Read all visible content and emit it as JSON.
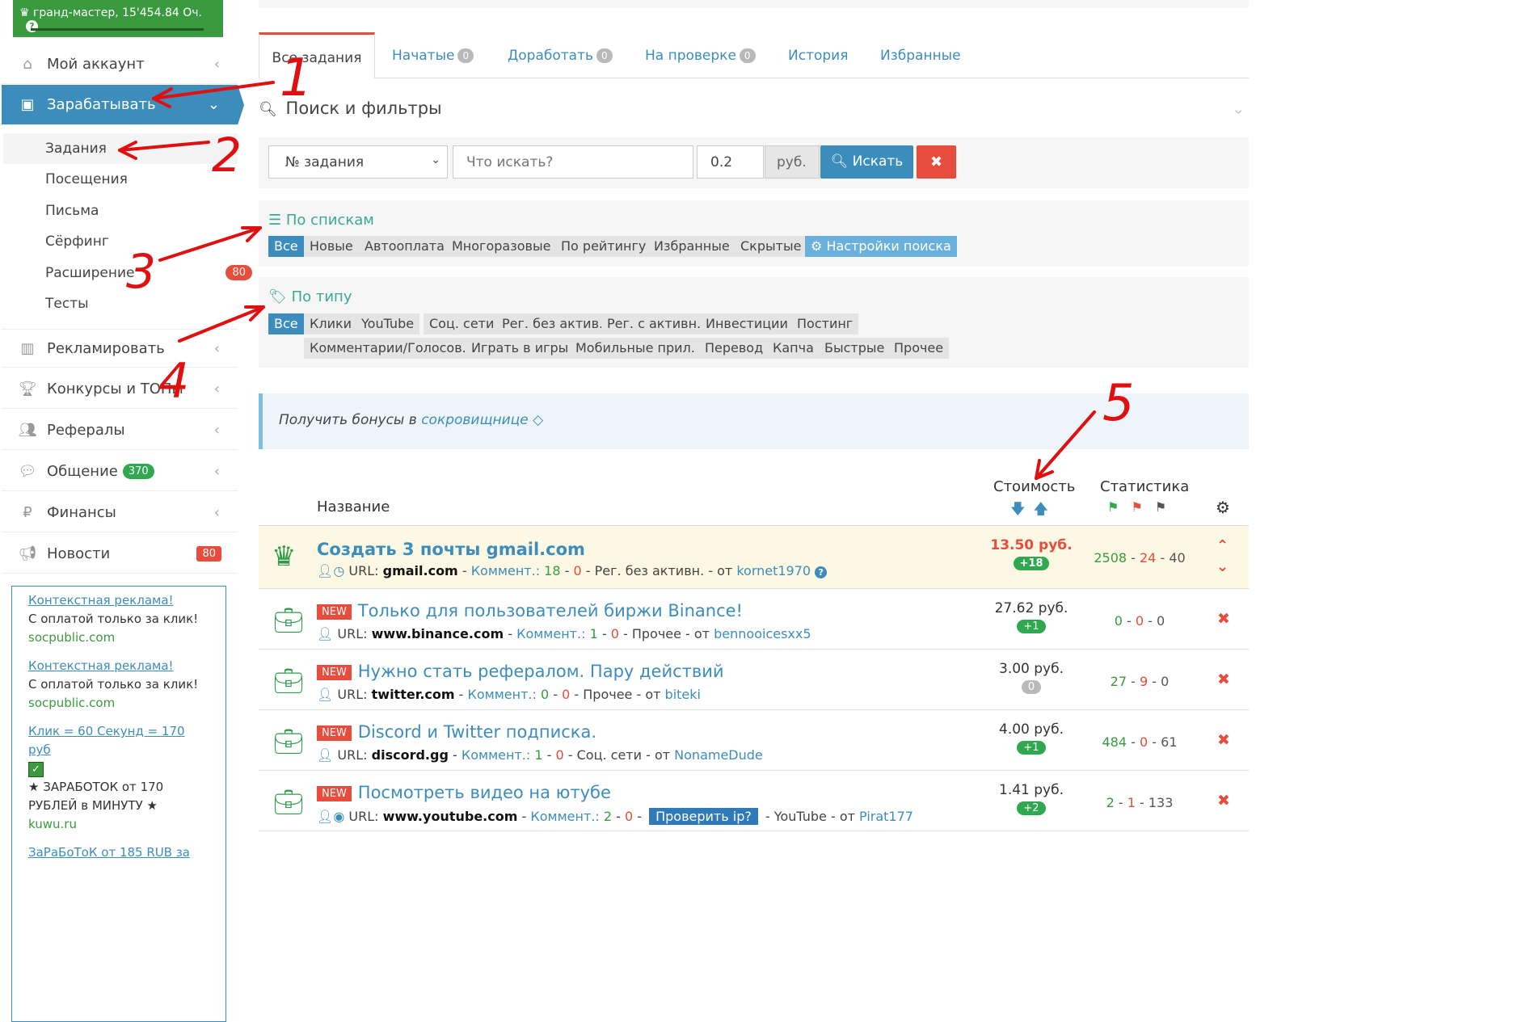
{
  "sidebar": {
    "rank": "гранд-мастер, 15'454.84 Оч.",
    "help": "?",
    "menu": [
      {
        "label": "Мой аккаунт",
        "icon": "home-icon"
      },
      {
        "label": "Зарабатывать",
        "icon": "briefcase-icon"
      },
      {
        "label": "Рекламировать",
        "icon": "bar-chart-icon"
      },
      {
        "label": "Конкурсы и ТОПы",
        "icon": "trophy-icon"
      },
      {
        "label": "Рефералы",
        "icon": "users-icon"
      },
      {
        "label": "Общение",
        "icon": "comments-icon",
        "badge": "370"
      },
      {
        "label": "Финансы",
        "icon": "ruble-icon"
      },
      {
        "label": "Новости",
        "icon": "megaphone-icon",
        "badge": "80"
      }
    ],
    "submenu": [
      {
        "label": "Задания"
      },
      {
        "label": "Посещения"
      },
      {
        "label": "Письма"
      },
      {
        "label": "Сёрфинг"
      },
      {
        "label": "Расширение",
        "badge": "80"
      },
      {
        "label": "Тесты"
      }
    ],
    "ads": [
      {
        "link": "Контекстная реклама!",
        "text": "С оплатой только за клик!",
        "site": "socpublic.com"
      },
      {
        "link": "Контекстная реклама!",
        "text": "С оплатой только за клик!",
        "site": "socpublic.com"
      },
      {
        "link": "Клик = 60 Секунд = 170 руб",
        "text": "★ ЗАРАБОТОК от 170 РУБЛЕЙ в МИНУТУ ★",
        "site": "kuwu.ru"
      },
      {
        "link": "ЗаРаБоТоК от 185 RUB за"
      }
    ]
  },
  "tabs": [
    {
      "label": "Все задания"
    },
    {
      "label": "Начатые",
      "count": "0"
    },
    {
      "label": "Доработать",
      "count": "0"
    },
    {
      "label": "На проверке",
      "count": "0"
    },
    {
      "label": "История"
    },
    {
      "label": "Избранные"
    }
  ],
  "filters": {
    "title": "Поиск и фильтры",
    "select_value": "№ задания",
    "search_placeholder": "Что искать?",
    "price_value": "0.2",
    "currency": "руб.",
    "search_button": "Искать"
  },
  "lists": {
    "title": "По спискам",
    "chips": [
      "Все",
      "Новые",
      "Автооплата",
      "Многоразовые",
      "По рейтингу",
      "Избранные",
      "Скрытые"
    ],
    "settings": "Настройки поиска"
  },
  "types": {
    "title": "По типу",
    "row1": [
      "Все",
      "Клики",
      "YouTube",
      "Соц. сети",
      "Рег. без актив.",
      "Рег. с активн.",
      "Инвестиции",
      "Постинг"
    ],
    "row2": [
      "Комментарии/Голосов.",
      "Играть в игры",
      "Мобильные прил.",
      "Перевод",
      "Капча",
      "Быстрые",
      "Прочее"
    ]
  },
  "bonus": {
    "text": "Получить бонусы в",
    "link": "сокровищнице"
  },
  "table": {
    "col_name": "Название",
    "col_cost": "Стоимость",
    "col_stats": "Статистика",
    "rows": [
      {
        "title": "Создать 3 почты gmail.com",
        "is_new": false,
        "url": "gmail.com",
        "comments_label": "Коммент.:",
        "c_pos": "18",
        "c_neg": "0",
        "category": "Рег. без активн.",
        "from": "от",
        "author": "kornet1970",
        "price": "13.50 руб.",
        "badge": "+18",
        "s1": "2508",
        "s2": "24",
        "s3": "40"
      },
      {
        "title": "Только для пользователей биржи Binance!",
        "is_new": true,
        "url": "www.binance.com",
        "comments_label": "Коммент.:",
        "c_pos": "1",
        "c_neg": "0",
        "category": "Прочее",
        "from": "от",
        "author": "bennooicesxx5",
        "price": "27.62 руб.",
        "badge": "+1",
        "s1": "0",
        "s2": "0",
        "s3": "0"
      },
      {
        "title": "Нужно стать рефералом. Пару действий",
        "is_new": true,
        "url": "twitter.com",
        "comments_label": "Коммент.:",
        "c_pos": "0",
        "c_neg": "0",
        "category": "Прочее",
        "from": "от",
        "author": "biteki",
        "price": "3.00 руб.",
        "badge": "0",
        "s1": "27",
        "s2": "9",
        "s3": "0"
      },
      {
        "title": "Discord и Twitter подписка.",
        "is_new": true,
        "url": "discord.gg",
        "comments_label": "Коммент.:",
        "c_pos": "1",
        "c_neg": "0",
        "category": "Соц. сети",
        "from": "от",
        "author": "NonameDude",
        "price": "4.00 руб.",
        "badge": "+1",
        "s1": "484",
        "s2": "0",
        "s3": "61"
      },
      {
        "title": "Посмотреть видео на ютубе",
        "is_new": true,
        "url": "www.youtube.com",
        "comments_label": "Коммент.:",
        "c_pos": "2",
        "c_neg": "0",
        "check_ip": "Проверить ip?",
        "category": "YouTube",
        "from": "от",
        "author": "Pirat177",
        "price": "1.41 руб.",
        "badge": "+2",
        "s1": "2",
        "s2": "1",
        "s3": "133"
      }
    ],
    "new_label": "NEW",
    "url_label": "URL:"
  },
  "annotations": [
    "1",
    "2",
    "3",
    "4",
    "5"
  ],
  "colors": {
    "accent": "#3c8dbc",
    "green": "#3a9a3f",
    "red": "#e74c3c",
    "annotation": "#e01010"
  }
}
